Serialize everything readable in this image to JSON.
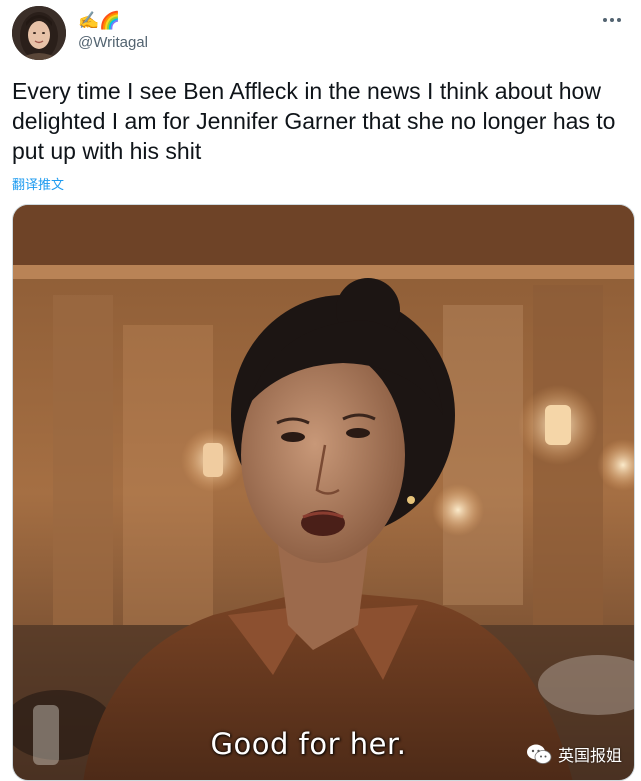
{
  "tweet": {
    "display_name_emoji": "✍️🌈",
    "handle": "@Writagal",
    "text": "Every time I see Ben Affleck in the news I think about how delighted I am for Jennifer Garner that she no longer has to put up with his shit",
    "translate_label": "翻译推文"
  },
  "media": {
    "subtitle": "Good for her.",
    "watermark": "英国报姐"
  },
  "icons": {
    "avatar": "profile-photo",
    "more": "more-horizontal-icon",
    "watermark": "wechat-icon"
  }
}
